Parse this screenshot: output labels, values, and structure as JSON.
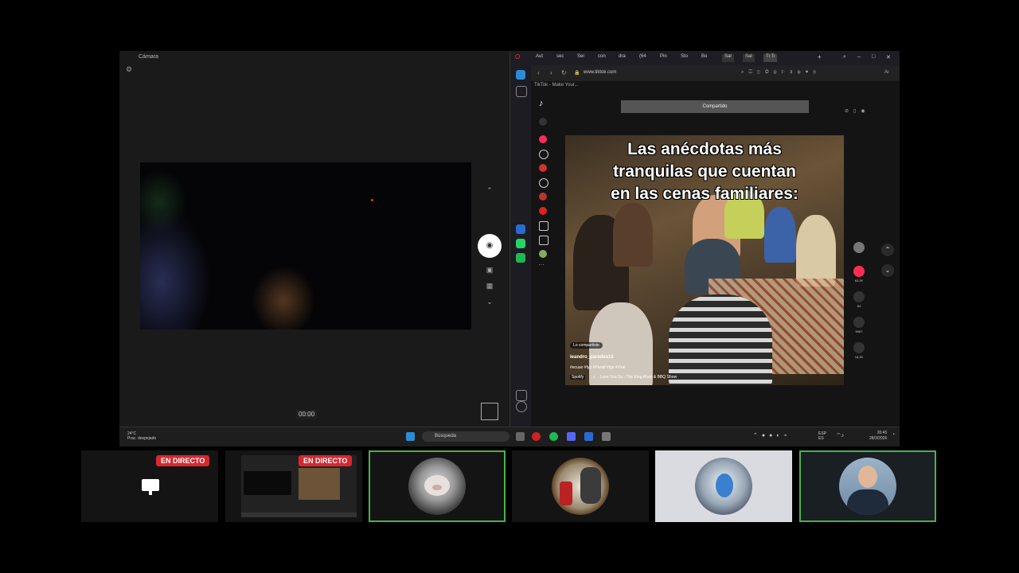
{
  "camera": {
    "title": "Cámara",
    "timer": "00:00"
  },
  "browser": {
    "tabs": [
      "Aut",
      "sec",
      "Ser",
      "con",
      "dra",
      "(64",
      "Pin",
      "Sto",
      "Bo",
      "Sal",
      "Sal",
      "Ti Ti"
    ],
    "url": "www.tiktok.com",
    "bookmark": "TikTok - Make Your...",
    "shared_banner": "Compartido",
    "video": {
      "caption_lines": [
        "Las anécdotas más",
        "tranquilas que cuentan",
        "en las cenas familiares:"
      ],
      "shared_pill": "Lo compartiste",
      "author": "leandro_paredes15",
      "hashtags": "#ecuao #fyp #Parati #fyp #Viral",
      "music": "Love You So - The King Khan & BBQ Show",
      "spotify": "Spotify"
    },
    "actions": [
      {
        "icon": "heart-icon",
        "count": "63,2K"
      },
      {
        "icon": "comment-icon",
        "count": "84"
      },
      {
        "icon": "bookmark-icon",
        "count": "5967"
      },
      {
        "icon": "share-icon",
        "count": "18,2K"
      }
    ]
  },
  "taskbar": {
    "weather_temp": "24°C",
    "weather_desc": "Prac. despejado",
    "search_placeholder": "Búsqueda",
    "lang_top": "ESP",
    "lang_bottom": "ES",
    "time": "20:45",
    "date": "28/3/2026"
  },
  "tiles": [
    {
      "live_label": "EN DIRECTO",
      "kind": "screen-share"
    },
    {
      "live_label": "EN DIRECTO",
      "kind": "screen-thumb"
    },
    {
      "kind": "avatar-pig"
    },
    {
      "kind": "avatar-emblem"
    },
    {
      "kind": "avatar-globe"
    },
    {
      "kind": "avatar-man"
    }
  ],
  "colors": {
    "live_red": "#d8282f",
    "active_border": "#4cb04c",
    "tiktok_pink": "#fe2c55"
  }
}
